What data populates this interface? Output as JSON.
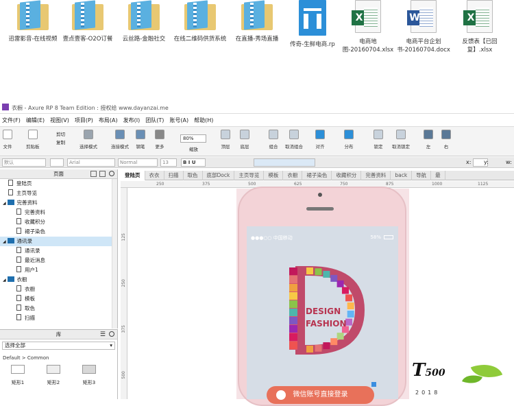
{
  "desktop_files": [
    {
      "type": "folder",
      "name": "迅雷影音-在线视频"
    },
    {
      "type": "folder",
      "name": "壹点壹客-O2O订餐"
    },
    {
      "type": "folder",
      "name": "云丝路-金融社交"
    },
    {
      "type": "folder",
      "name": "在线二维码供货系统"
    },
    {
      "type": "folder",
      "name": "在直播-秀场直播"
    },
    {
      "type": "rp",
      "name": "传奇-生鲜电商.rp"
    },
    {
      "type": "xlsx",
      "name": "电商地图-20160704.xlsx"
    },
    {
      "type": "docx",
      "name": "电商平台企划书-20160704.docx"
    },
    {
      "type": "xlsx",
      "name": "反馈表【已回复】.xlsx"
    }
  ],
  "window": {
    "title": "衣橱 - Axure RP 8 Team Edition : 授权给 www.dayanzai.me"
  },
  "menu": [
    "文件(F)",
    "编辑(E)",
    "视图(V)",
    "项目(P)",
    "布局(A)",
    "发布(I)",
    "团队(T)",
    "账号(A)",
    "帮助(H)"
  ],
  "toolbar": {
    "new": "文件",
    "paste": "剪贴板",
    "cut": "剪切",
    "copy": "复制",
    "select": "选择模式",
    "connect": "连接模式",
    "pen": "钢笔",
    "more": "更多",
    "zoom_value": "80%",
    "zoom_label": "缩放",
    "top": "顶层",
    "bottom": "底层",
    "group": "组合",
    "ungroup": "取消组合",
    "align": "对齐",
    "distribute": "分布",
    "lock": "锁定",
    "unlock": "取消锁定",
    "left": "左",
    "right": "右"
  },
  "formatbar": {
    "style": "默认",
    "font": "Arial",
    "weight": "Normal",
    "size": "13",
    "x_label": "x:",
    "y_label": "y:",
    "w_label": "w:"
  },
  "pages_panel": {
    "title": "页面",
    "items": [
      {
        "label": "登陆页",
        "kind": "page",
        "level": 1
      },
      {
        "label": "主页导览",
        "kind": "page",
        "level": 1
      },
      {
        "label": "完善资料",
        "kind": "folder",
        "level": 0
      },
      {
        "label": "完善资料",
        "kind": "page",
        "level": 2
      },
      {
        "label": "收藏积分",
        "kind": "page",
        "level": 2
      },
      {
        "label": "裙子染色",
        "kind": "page",
        "level": 2
      },
      {
        "label": "通讯录",
        "kind": "folder",
        "level": 0,
        "selected": true
      },
      {
        "label": "通讯录",
        "kind": "page",
        "level": 2
      },
      {
        "label": "最近消息",
        "kind": "page",
        "level": 2
      },
      {
        "label": "用户1",
        "kind": "page",
        "level": 2
      },
      {
        "label": "衣橱",
        "kind": "folder",
        "level": 0
      },
      {
        "label": "衣橱",
        "kind": "page",
        "level": 2
      },
      {
        "label": "模板",
        "kind": "page",
        "level": 2
      },
      {
        "label": "取色",
        "kind": "page",
        "level": 2
      },
      {
        "label": "扫描",
        "kind": "page",
        "level": 2
      }
    ]
  },
  "library_panel": {
    "title": "库",
    "select_all": "选择全部",
    "breadcrumb": "Default > Common",
    "widgets": [
      "矩形1",
      "矩形2",
      "矩形3"
    ]
  },
  "tabs": [
    "登陆页",
    "衣衣",
    "扫描",
    "取色",
    "底部Dock",
    "主页导览",
    "模板",
    "衣橱",
    "裙子染色",
    "收藏积分",
    "完善资料",
    "back",
    "导航",
    "最"
  ],
  "ruler_h": [
    "250",
    "375",
    "500",
    "625",
    "750",
    "875",
    "1000",
    "1125"
  ],
  "ruler_v": [
    "125",
    "250",
    "375",
    "500"
  ],
  "phone_screen": {
    "carrier": "中国移动",
    "battery": "58%",
    "logo_line1": "DESIGN",
    "logo_line2": "FASHION",
    "wechat_button": "微信账号直接登录"
  },
  "watermark": {
    "year": "2018"
  },
  "colors": {
    "folder_blue": "#5ab0e0",
    "excel_green": "#1f7244",
    "word_blue": "#2b579a",
    "rp_blue": "#2c8fd8",
    "selection": "#cfe6f7",
    "wechat_orange": "#e8715a",
    "phone_pink": "#f3d3d7"
  }
}
